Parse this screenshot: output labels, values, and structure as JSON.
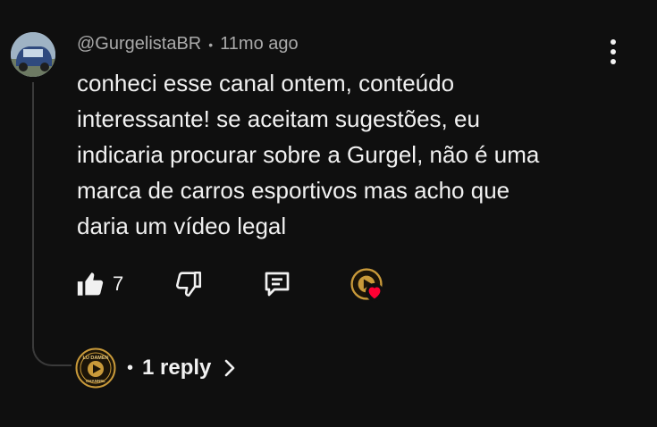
{
  "comment": {
    "author": "@GurgelistaBR",
    "separator": "•",
    "time": "11mo ago",
    "lines": [
      "conheci esse canal ontem, conteúdo",
      "interessante! se aceitam sugestões, eu",
      "indicaria procurar sobre a Gurgel, não é uma",
      "marca de carros esportivos mas acho que",
      "daria um vídeo legal"
    ],
    "like_count": "7"
  },
  "replies": {
    "separator": "•",
    "label": "1 reply"
  },
  "icons": {
    "like": "thumb-up-icon",
    "dislike": "thumb-down-icon",
    "reply": "comment-icon",
    "menu": "more-vert-icon",
    "chevron": "chevron-right-icon",
    "creator_heart": "heart-icon"
  },
  "creator_badge": {
    "top_text": "LU DAMEN",
    "bottom_text": "CHANNEL"
  },
  "colors": {
    "background": "#0f0f0f",
    "text": "#f1f1f1",
    "meta": "#aaaaaa",
    "heart": "#ff0033",
    "badge_gold": "#c99a3a"
  }
}
